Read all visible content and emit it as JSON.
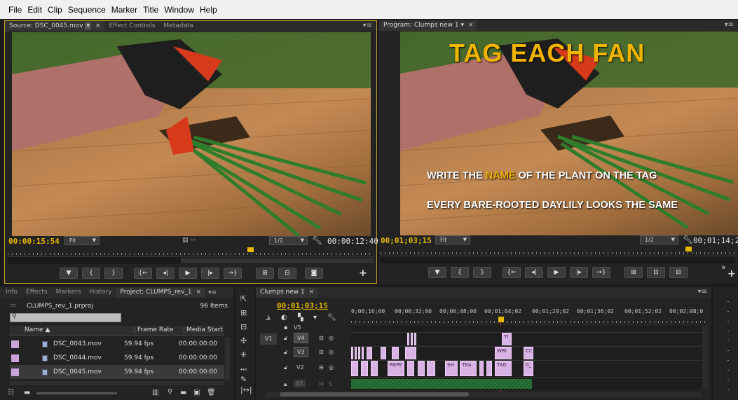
{
  "menu": [
    "File",
    "Edit",
    "Clip",
    "Sequence",
    "Marker",
    "Title",
    "Window",
    "Help"
  ],
  "source": {
    "tabs": [
      {
        "label": "Source: DSC_0045.mov",
        "active": true
      },
      {
        "label": "Effect Controls",
        "active": false
      },
      {
        "label": "Metadata",
        "active": false
      }
    ],
    "timecode_in": "00:00:15:54",
    "zoom": "Fit",
    "resolution": "1/2",
    "timecode_dur": "00:00:12:40",
    "playhead_fraction": 0.64
  },
  "program": {
    "tab": "Program: Clumps new 1",
    "title_overlay": "TAG EACH FAN",
    "line1_pre": "WRITE THE ",
    "line1_hl": "NAME",
    "line1_post": " OF THE PLANT ON THE TAG",
    "line2": "EVERY BARE-ROOTED DAYLILY LOOKS THE SAME",
    "timecode_in": "00;01;03;15",
    "zoom": "Fit",
    "resolution": "1/2",
    "timecode_dur": "00;01;14;2",
    "playhead_fraction": 0.855
  },
  "project": {
    "tabs": [
      {
        "label": "Info",
        "active": false
      },
      {
        "label": "Effects",
        "active": false
      },
      {
        "label": "Markers",
        "active": false
      },
      {
        "label": "History",
        "active": false
      },
      {
        "label": "Project: CLUMPS_rev_1",
        "active": true
      }
    ],
    "file": "CLUMPS_rev_1.prproj",
    "count": "96 Items",
    "search_placeholder": "",
    "columns": [
      "Name",
      "Frame Rate",
      "Media Start"
    ],
    "items": [
      {
        "name": "DSC_0043.mov",
        "fps": "59.94 fps",
        "start": "00:00:00:00"
      },
      {
        "name": "DSC_0044.mov",
        "fps": "59.94 fps",
        "start": "00:00:00:00"
      },
      {
        "name": "DSC_0045.mov",
        "fps": "59.94 fps",
        "start": "00:00:00:00"
      }
    ]
  },
  "timeline": {
    "tab": "Clumps new 1",
    "timecode": "00;01;03;15",
    "ruler": [
      "0;00;16;00",
      "00;00;32;00",
      "00;00;48;00",
      "00;01;04;02",
      "00;01;20;02",
      "00;01;36;02",
      "00;01;52;02",
      "00;02;08;0"
    ],
    "tracks": [
      "V5",
      "V4",
      "V3",
      "V2",
      "A1"
    ],
    "src_patch": "V1",
    "clip_labels": [
      "TI",
      "WRI",
      "CC",
      "REPE",
      "SH",
      "TEA",
      "TAG",
      "0_"
    ]
  },
  "colors": {
    "accent": "#e6b800",
    "clip": "#d9b3e6",
    "audio": "#2a7a3a"
  }
}
